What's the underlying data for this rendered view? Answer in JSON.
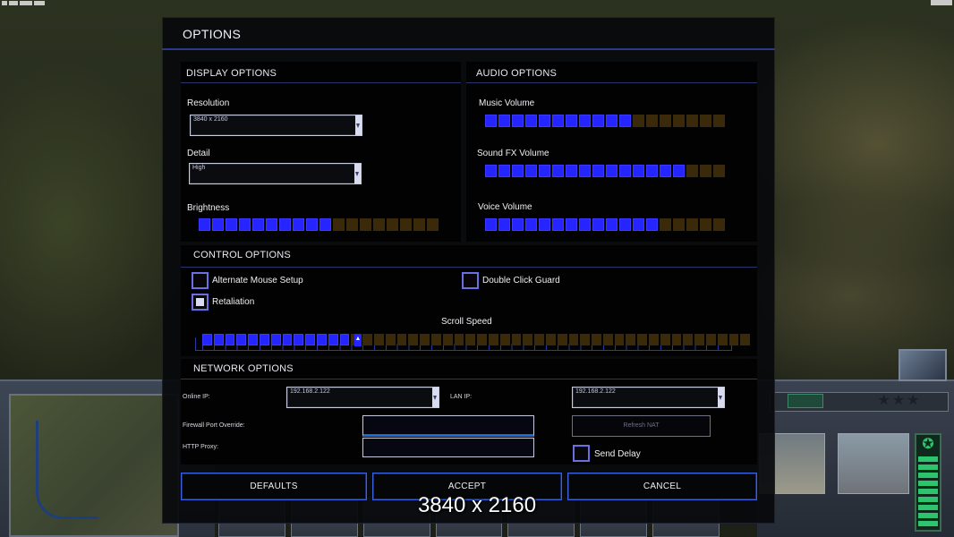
{
  "dialog": {
    "title": "OPTIONS",
    "display": {
      "heading": "DISPLAY OPTIONS",
      "resolution_label": "Resolution",
      "resolution_value": "3840 x 2160",
      "detail_label": "Detail",
      "detail_value": "High",
      "brightness_label": "Brightness",
      "brightness_level": 10,
      "brightness_segments": 18
    },
    "audio": {
      "heading": "AUDIO OPTIONS",
      "music_label": "Music Volume",
      "music_level": 11,
      "music_segments": 18,
      "sfx_label": "Sound FX Volume",
      "sfx_level": 15,
      "sfx_segments": 18,
      "voice_label": "Voice Volume",
      "voice_level": 13,
      "voice_segments": 18
    },
    "control": {
      "heading": "CONTROL OPTIONS",
      "alternate_mouse_label": "Alternate Mouse Setup",
      "alternate_mouse_checked": false,
      "retaliation_label": "Retaliation",
      "retaliation_checked": true,
      "double_click_label": "Double Click Guard",
      "double_click_checked": false,
      "scroll_label": "Scroll Speed",
      "scroll_level": 13,
      "scroll_segments": 48
    },
    "network": {
      "heading": "NETWORK OPTIONS",
      "online_ip_label": "Online IP:",
      "online_ip_value": "192.168.2.122",
      "lan_ip_label": "LAN IP:",
      "lan_ip_value": "192.168.2.122",
      "firewall_label": "Firewall Port Override:",
      "firewall_value": "",
      "proxy_label": "HTTP Proxy:",
      "proxy_value": "",
      "refresh_nat_label": "Refresh NAT",
      "send_delay_label": "Send Delay",
      "send_delay_checked": false
    },
    "buttons": {
      "defaults": "DEFAULTS",
      "accept": "ACCEPT",
      "cancel": "CANCEL"
    }
  },
  "caption": "3840 x 2160",
  "colors": {
    "slider_on": "#2525ff",
    "slider_off": "#3a2a0a",
    "accent_border": "#3a62e0"
  }
}
